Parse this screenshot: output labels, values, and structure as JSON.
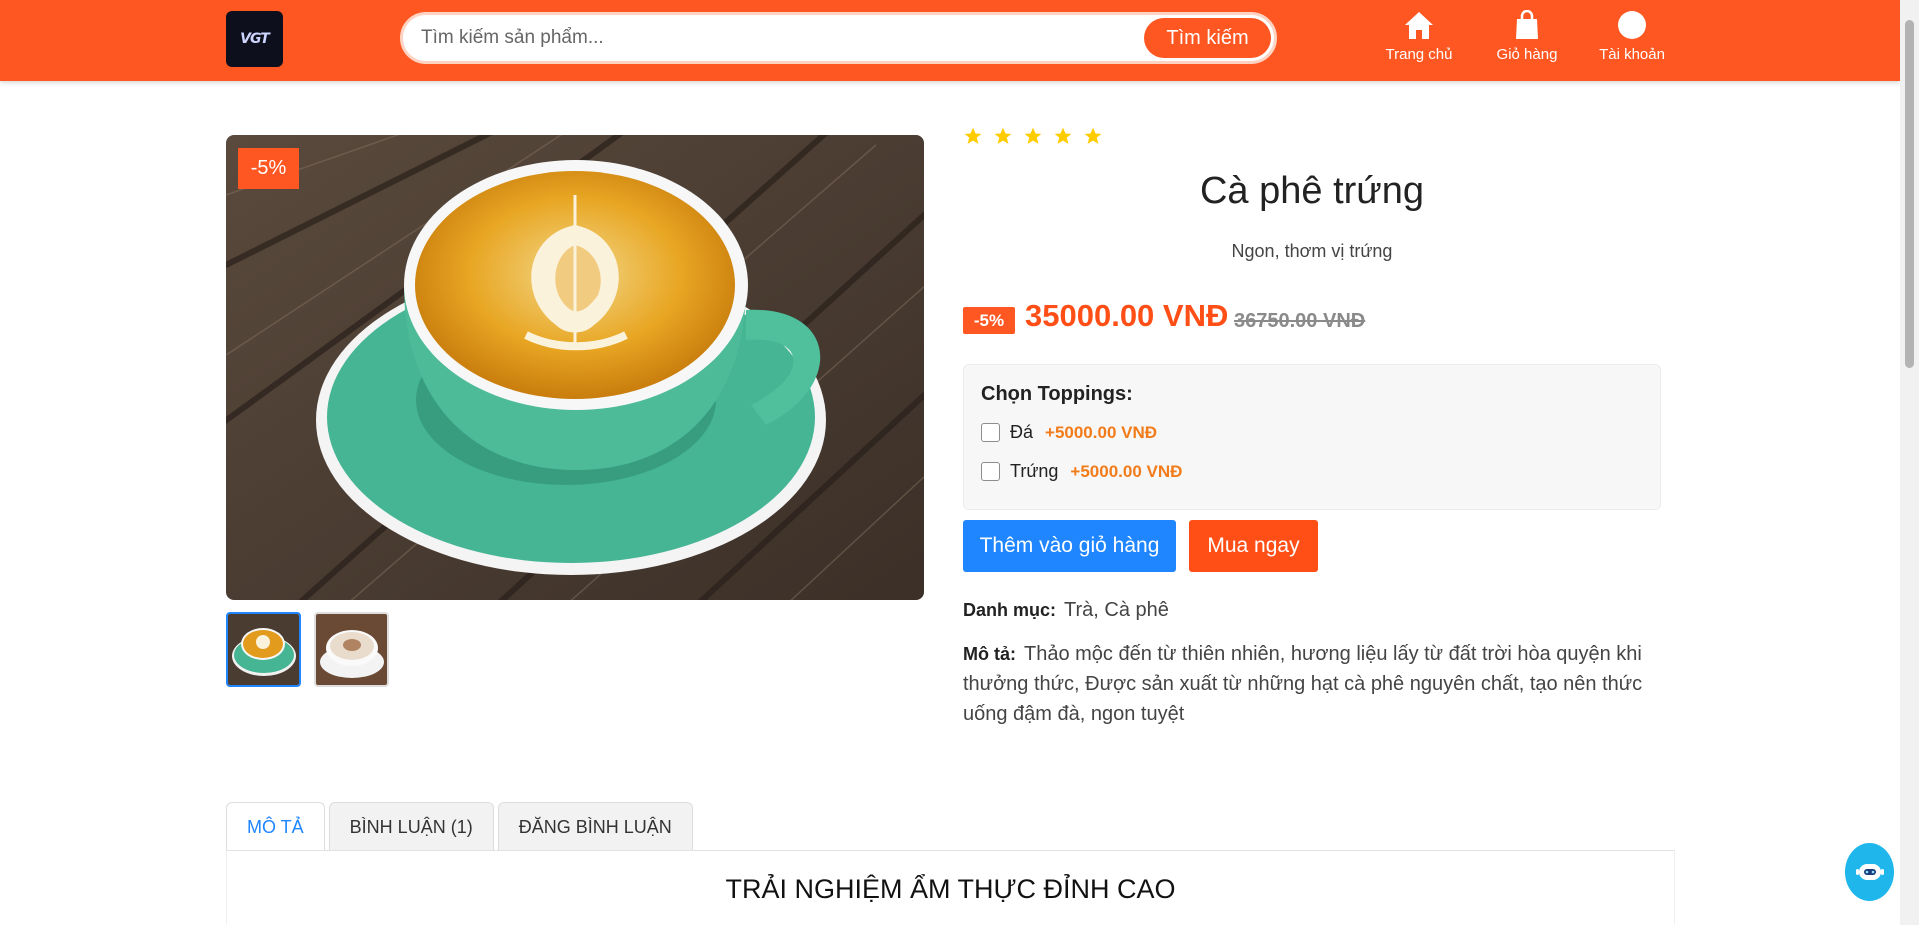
{
  "header": {
    "logo_text": "VGT",
    "search_placeholder": "Tìm kiếm sản phẩm...",
    "search_button": "Tìm kiếm",
    "nav": [
      {
        "label": "Trang chủ",
        "icon": "home-icon"
      },
      {
        "label": "Giỏ hàng",
        "icon": "shopping-bag-icon"
      },
      {
        "label": "Tài khoản",
        "icon": "user-icon"
      }
    ]
  },
  "gallery": {
    "sale_tag": "-5%",
    "thumbnails": [
      "latte-green-cup",
      "cappuccino-white-cup"
    ],
    "active_index": 0
  },
  "product": {
    "rating": 5,
    "title": "Cà phê trứng",
    "subtitle": "Ngon, thơm vị trứng",
    "discount_badge": "-5%",
    "price": "35000.00 VNĐ",
    "old_price": "36750.00 VNĐ",
    "toppings_title": "Chọn Toppings:",
    "toppings": [
      {
        "name": "Đá",
        "price": "+5000.00 VNĐ",
        "checked": false
      },
      {
        "name": "Trứng",
        "price": "+5000.00 VNĐ",
        "checked": false
      }
    ],
    "add_to_cart": "Thêm vào giỏ hàng",
    "buy_now": "Mua ngay",
    "category_label": "Danh mục:",
    "category_value": "Trà, Cà phê",
    "description_label": "Mô tả:",
    "description": "Thảo mộc đến từ thiên nhiên, hương liệu lấy từ đất trời hòa quyện khi thưởng thức, Được sản xuất từ những hạt cà phê nguyên chất, tạo nên thức uống đậm đà, ngon tuyệt"
  },
  "tabs": [
    {
      "label": "MÔ TẢ",
      "active": true
    },
    {
      "label": "BÌNH LUẬN (1)",
      "active": false
    },
    {
      "label": "ĐĂNG BÌNH LUẬN",
      "active": false
    }
  ],
  "tab_content_title": "TRẢI NGHIỆM ẨM THỰC ĐỈNH CAO",
  "colors": {
    "brand": "#ff5722",
    "primary_button": "#1f86ff",
    "star": "#ffcc00",
    "topping_price": "#f27b1a"
  }
}
